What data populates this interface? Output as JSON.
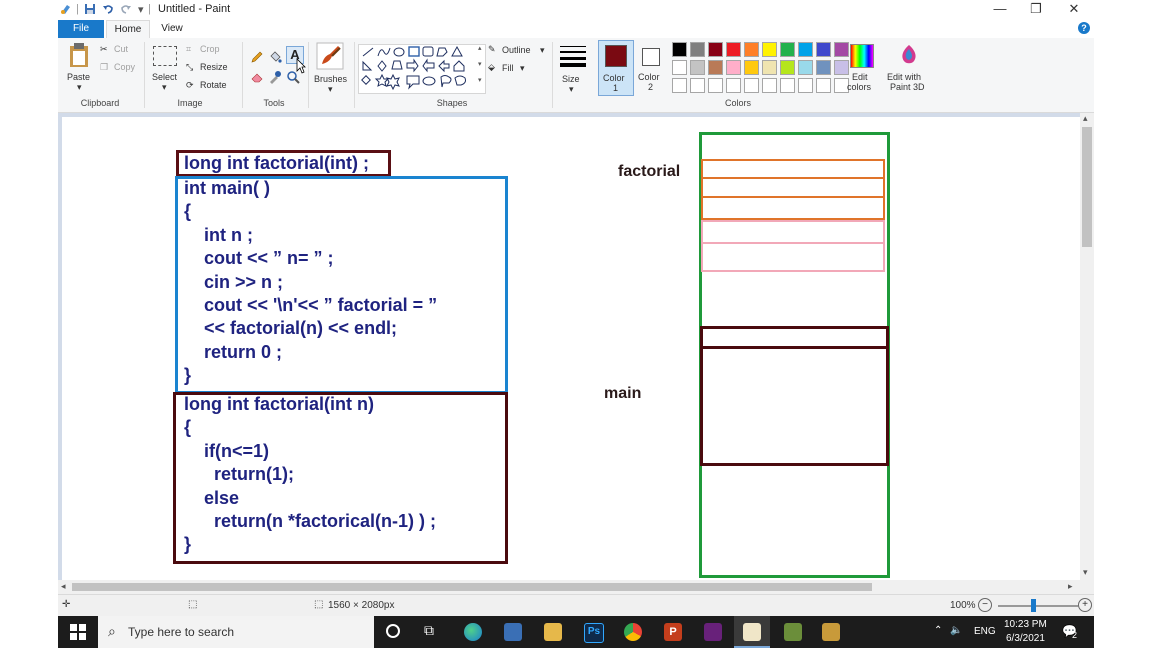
{
  "window": {
    "title": "Untitled - Paint"
  },
  "tabs": {
    "file": "File",
    "home": "Home",
    "view": "View"
  },
  "ribbon": {
    "clipboard": {
      "paste": "Paste",
      "cut": "Cut",
      "copy": "Copy",
      "label": "Clipboard"
    },
    "image": {
      "select": "Select",
      "crop": "Crop",
      "resize": "Resize",
      "rotate": "Rotate",
      "label": "Image"
    },
    "tools": {
      "label": "Tools"
    },
    "brushes": {
      "label": "Brushes"
    },
    "shapes": {
      "outline": "Outline",
      "fill": "Fill",
      "label": "Shapes"
    },
    "size": {
      "label": "Size"
    },
    "color1": {
      "label1": "Color",
      "label2": "1",
      "value": "#7a0a12"
    },
    "color2": {
      "label1": "Color",
      "label2": "2",
      "value": "#ffffff"
    },
    "colors": {
      "label": "Colors",
      "row1": [
        "#000000",
        "#7f7f7f",
        "#880015",
        "#ed1c24",
        "#ff7f27",
        "#fff200",
        "#22b14c",
        "#00a2e8",
        "#3f48cc",
        "#a349a4"
      ],
      "row2": [
        "#ffffff",
        "#c3c3c3",
        "#b97a57",
        "#ffaec9",
        "#ffc90e",
        "#efe4b0",
        "#b5e61d",
        "#99d9ea",
        "#7092be",
        "#c8bfe7"
      ]
    },
    "edit_colors": {
      "line1": "Edit",
      "line2": "colors"
    },
    "paint3d": {
      "line1": "Edit with",
      "line2": "Paint 3D"
    }
  },
  "canvas": {
    "prototype": "long int factorial(int) ;",
    "main_lines": [
      "int main( )",
      "{",
      "    int n ;",
      "    cout << ” n= ” ;",
      "    cin >> n ;",
      "    cout << '\\n'<< ” factorial = ”",
      "    << factorial(n) << endl;",
      "    return 0 ;",
      "}"
    ],
    "func_lines": [
      "long int factorial(int n)",
      "{",
      "    if(n<=1)",
      "      return(1);",
      "    else",
      "      return(n *factorical(n-1) ) ;",
      "}"
    ],
    "stack_label_factorial": "factorial",
    "stack_label_main": "main"
  },
  "status": {
    "dimensions": "1560 × 2080px",
    "zoom": "100%"
  },
  "taskbar": {
    "search_placeholder": "Type here to search",
    "lang": "ENG",
    "time": "10:23 PM",
    "date": "6/3/2021",
    "notifications": "2"
  }
}
